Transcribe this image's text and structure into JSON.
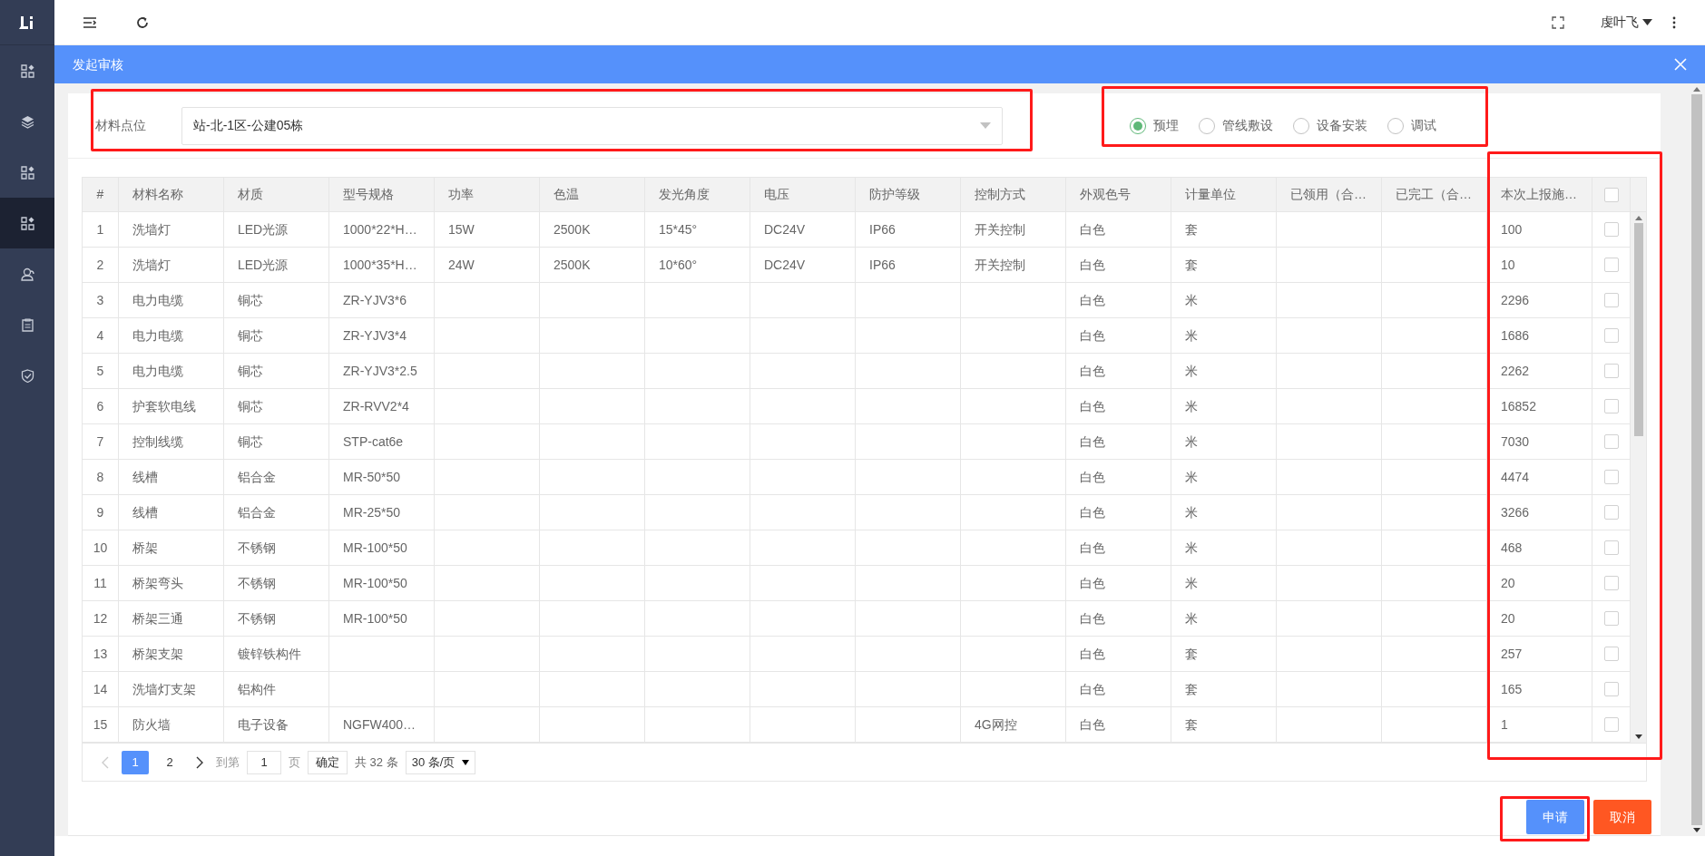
{
  "sidebar": {
    "items": [
      {
        "kind": "grid",
        "selected": false
      },
      {
        "kind": "layers",
        "selected": false
      },
      {
        "kind": "grid",
        "selected": false
      },
      {
        "kind": "grid",
        "selected": true
      },
      {
        "kind": "user",
        "selected": false
      },
      {
        "kind": "clipboard",
        "selected": false
      },
      {
        "kind": "shield",
        "selected": false
      }
    ]
  },
  "topbar": {
    "user": "虔叶飞"
  },
  "dialog": {
    "title": "发起审核"
  },
  "filter": {
    "label": "材料点位",
    "value": "站-北-1区-公建05栋"
  },
  "stages": [
    {
      "label": "预埋",
      "selected": true
    },
    {
      "label": "管线敷设",
      "selected": false
    },
    {
      "label": "设备安装",
      "selected": false
    },
    {
      "label": "调试",
      "selected": false
    }
  ],
  "table": {
    "header_checked": false,
    "columns": [
      "#",
      "材料名称",
      "材质",
      "型号规格",
      "功率",
      "色温",
      "发光角度",
      "电压",
      "防护等级",
      "控制方式",
      "外观色号",
      "计量单位",
      "已领用（合…",
      "已完工（合…",
      "本次上报施…"
    ],
    "rows": [
      {
        "cells": [
          "1",
          "洗墙灯",
          "LED光源",
          "1000*22*H…",
          "15W",
          "2500K",
          "15*45°",
          "DC24V",
          "IP66",
          "开关控制",
          "白色",
          "套",
          null,
          null,
          "100"
        ],
        "checked": false
      },
      {
        "cells": [
          "2",
          "洗墙灯",
          "LED光源",
          "1000*35*H…",
          "24W",
          "2500K",
          "10*60°",
          "DC24V",
          "IP66",
          "开关控制",
          "白色",
          "套",
          null,
          null,
          "10"
        ],
        "checked": false
      },
      {
        "cells": [
          "3",
          "电力电缆",
          "铜芯",
          "ZR-YJV3*6",
          null,
          null,
          null,
          null,
          null,
          null,
          "白色",
          "米",
          null,
          null,
          "2296"
        ],
        "checked": false
      },
      {
        "cells": [
          "4",
          "电力电缆",
          "铜芯",
          "ZR-YJV3*4",
          null,
          null,
          null,
          null,
          null,
          null,
          "白色",
          "米",
          null,
          null,
          "1686"
        ],
        "checked": false
      },
      {
        "cells": [
          "5",
          "电力电缆",
          "铜芯",
          "ZR-YJV3*2.5",
          null,
          null,
          null,
          null,
          null,
          null,
          "白色",
          "米",
          null,
          null,
          "2262"
        ],
        "checked": false
      },
      {
        "cells": [
          "6",
          "护套软电线",
          "铜芯",
          "ZR-RVV2*4",
          null,
          null,
          null,
          null,
          null,
          null,
          "白色",
          "米",
          null,
          null,
          "16852"
        ],
        "checked": false
      },
      {
        "cells": [
          "7",
          "控制线缆",
          "铜芯",
          "STP-cat6e",
          null,
          null,
          null,
          null,
          null,
          null,
          "白色",
          "米",
          null,
          null,
          "7030"
        ],
        "checked": false
      },
      {
        "cells": [
          "8",
          "线槽",
          "铝合金",
          "MR-50*50",
          null,
          null,
          null,
          null,
          null,
          null,
          "白色",
          "米",
          null,
          null,
          "4474"
        ],
        "checked": false
      },
      {
        "cells": [
          "9",
          "线槽",
          "铝合金",
          "MR-25*50",
          null,
          null,
          null,
          null,
          null,
          null,
          "白色",
          "米",
          null,
          null,
          "3266"
        ],
        "checked": false
      },
      {
        "cells": [
          "10",
          "桥架",
          "不锈钢",
          "MR-100*50",
          null,
          null,
          null,
          null,
          null,
          null,
          "白色",
          "米",
          null,
          null,
          "468"
        ],
        "checked": false
      },
      {
        "cells": [
          "11",
          "桥架弯头",
          "不锈钢",
          "MR-100*50",
          null,
          null,
          null,
          null,
          null,
          null,
          "白色",
          "米",
          null,
          null,
          "20"
        ],
        "checked": false
      },
      {
        "cells": [
          "12",
          "桥架三通",
          "不锈钢",
          "MR-100*50",
          null,
          null,
          null,
          null,
          null,
          null,
          "白色",
          "米",
          null,
          null,
          "20"
        ],
        "checked": false
      },
      {
        "cells": [
          "13",
          "桥架支架",
          "镀锌铁构件",
          null,
          null,
          null,
          null,
          null,
          null,
          null,
          "白色",
          "套",
          null,
          null,
          "257"
        ],
        "checked": false
      },
      {
        "cells": [
          "14",
          "洗墙灯支架",
          "铝构件",
          null,
          null,
          null,
          null,
          null,
          null,
          null,
          "白色",
          "套",
          null,
          null,
          "165"
        ],
        "checked": false
      },
      {
        "cells": [
          "15",
          "防火墙",
          "电子设备",
          "NGFW400…",
          null,
          null,
          null,
          null,
          null,
          "4G网控",
          "白色",
          "套",
          null,
          null,
          "1"
        ],
        "checked": false
      }
    ]
  },
  "pagination": {
    "pages": [
      {
        "label": "1",
        "selected": true
      },
      {
        "label": "2",
        "selected": false
      }
    ],
    "goto_label": "到第",
    "goto_value": "1",
    "page_suffix": "页",
    "confirm": "确定",
    "total": "共 32 条",
    "page_size": "30 条/页"
  },
  "buttons": [
    {
      "label": "申请",
      "kind": "primary"
    },
    {
      "label": "取消",
      "kind": "danger"
    }
  ]
}
